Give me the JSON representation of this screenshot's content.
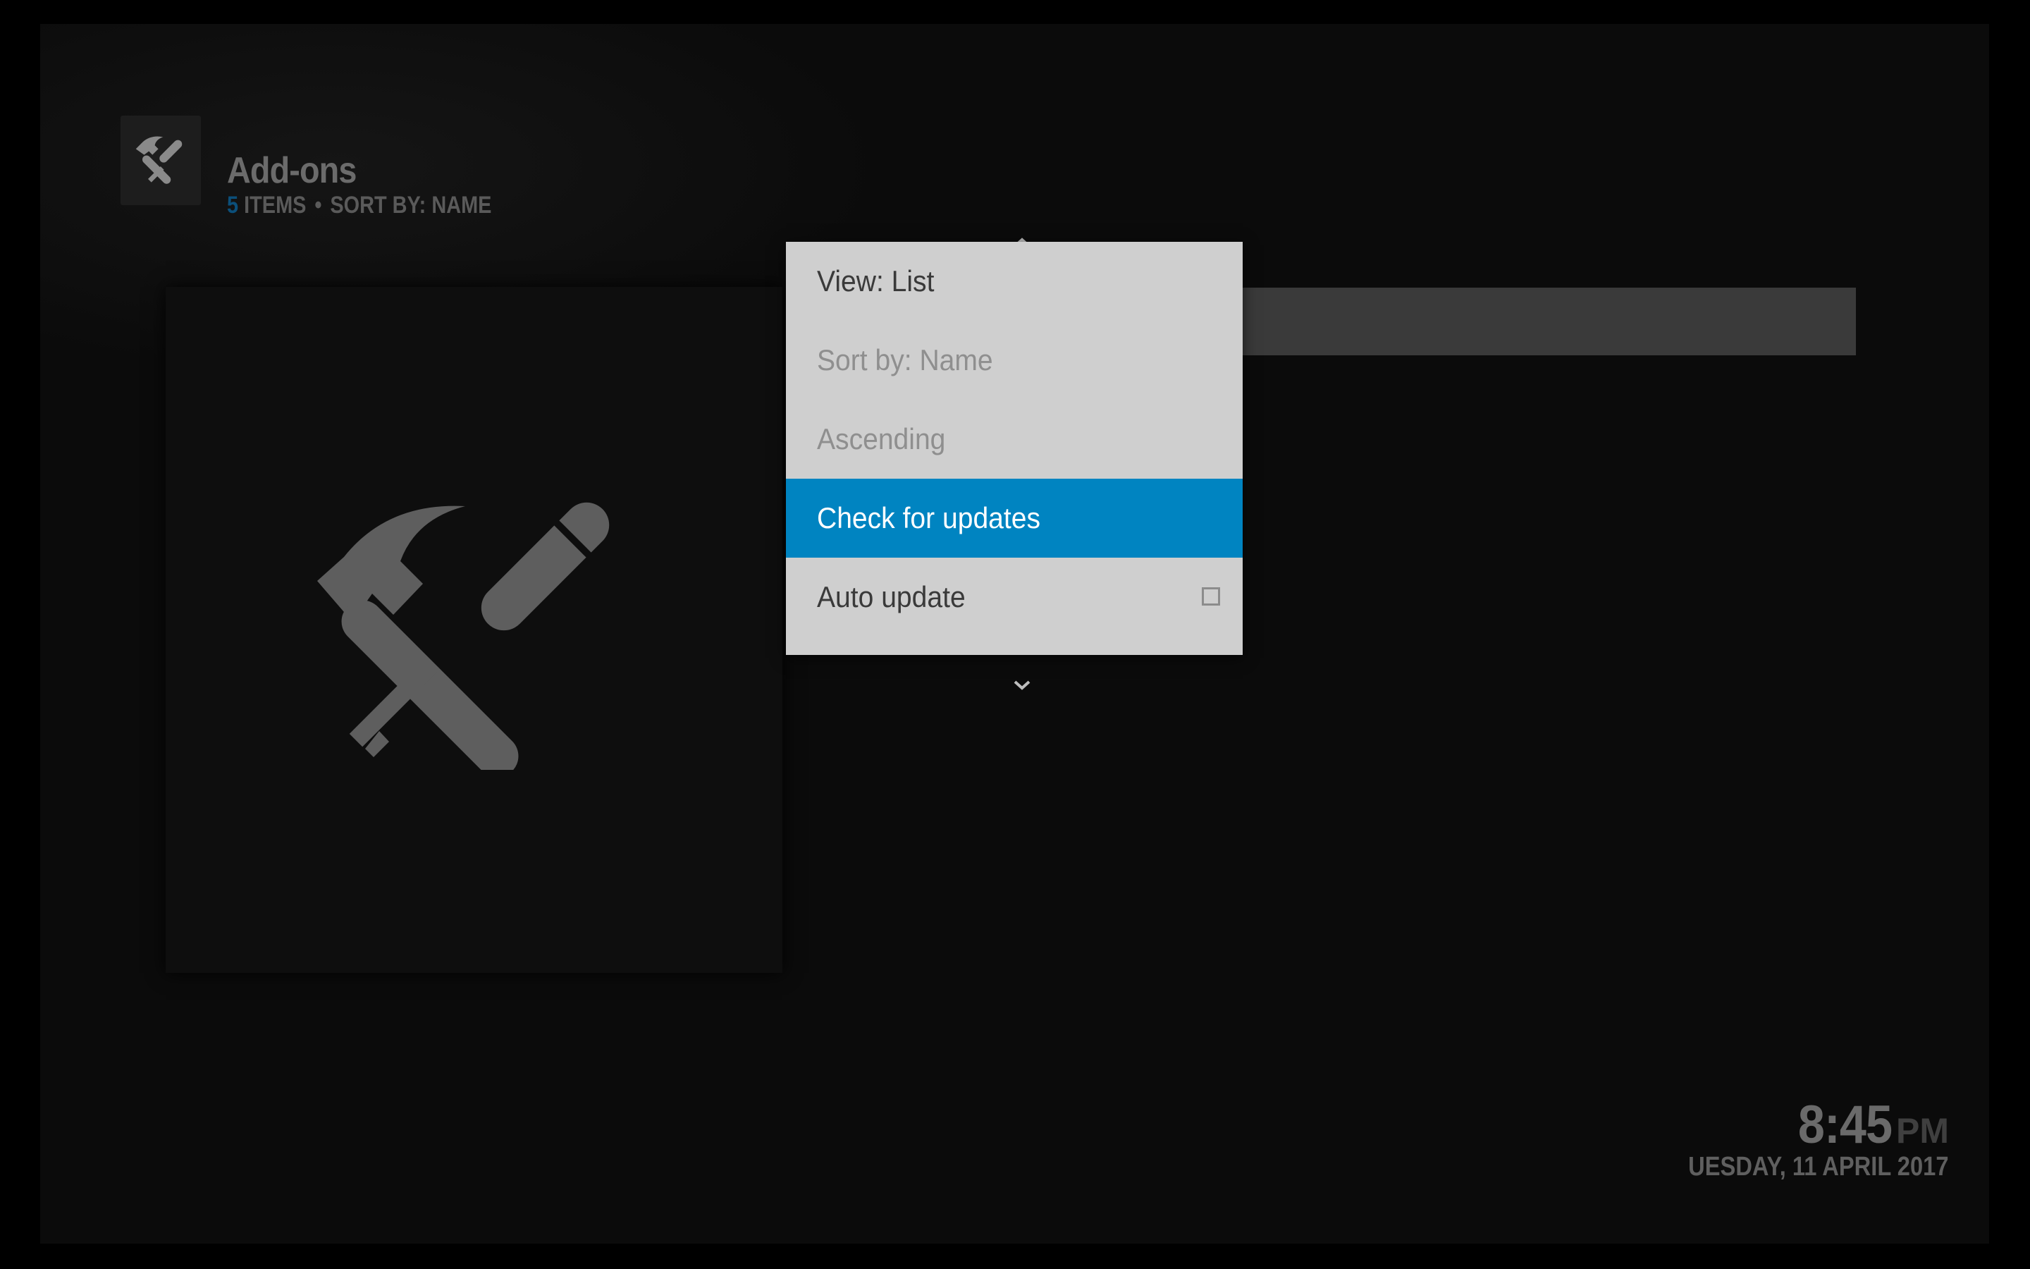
{
  "header": {
    "title": "Add-ons",
    "count": "5",
    "items_label": "ITEMS",
    "separator": "•",
    "sort_label": "SORT BY: NAME"
  },
  "context_menu": {
    "items": [
      {
        "label": "View: List",
        "state": "normal"
      },
      {
        "label": "Sort by: Name",
        "state": "disabled"
      },
      {
        "label": "Ascending",
        "state": "disabled"
      },
      {
        "label": "Check for updates",
        "state": "focused"
      },
      {
        "label": "Auto update",
        "state": "normal",
        "checkbox": false
      }
    ]
  },
  "clock": {
    "time": "8:45",
    "ampm": "PM",
    "date": "UESDAY, 11 APRIL 2017"
  },
  "colors": {
    "accent": "#0084c1",
    "menu_bg": "#cfcfcf",
    "background": "#0b0b0b"
  },
  "icons": {
    "header": "hammer-screwdriver-icon",
    "artwork": "hammer-screwdriver-icon",
    "scroll_up": "chevron-up-icon",
    "scroll_down": "chevron-down-icon"
  }
}
